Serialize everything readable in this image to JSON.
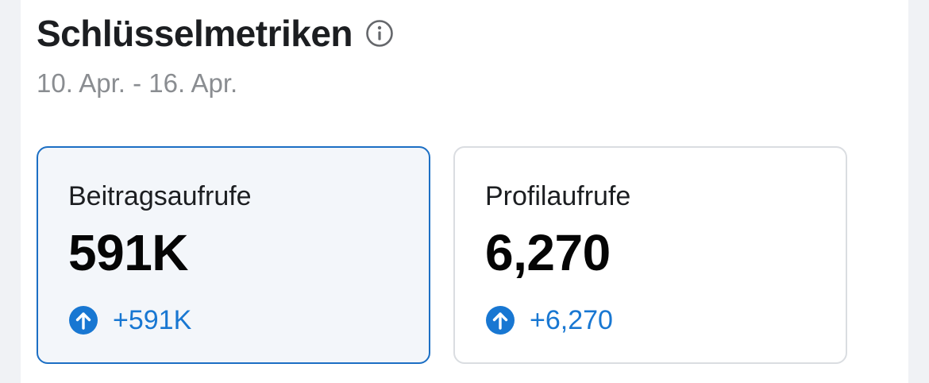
{
  "header": {
    "title": "Schlüsselmetriken",
    "info_icon": "info-icon",
    "date_range": "10. Apr. - 16. Apr."
  },
  "metrics": [
    {
      "label": "Beitragsaufrufe",
      "value": "591K",
      "change": "+591K",
      "change_icon": "arrow-up-circle-icon",
      "selected": true
    },
    {
      "label": "Profilaufrufe",
      "value": "6,270",
      "change": "+6,270",
      "change_icon": "arrow-up-circle-icon",
      "selected": false
    }
  ],
  "colors": {
    "accent": "#1877d2",
    "selected_border": "#1c6fc4",
    "selected_background": "#f3f6fa",
    "muted_text": "#8a8d91"
  }
}
